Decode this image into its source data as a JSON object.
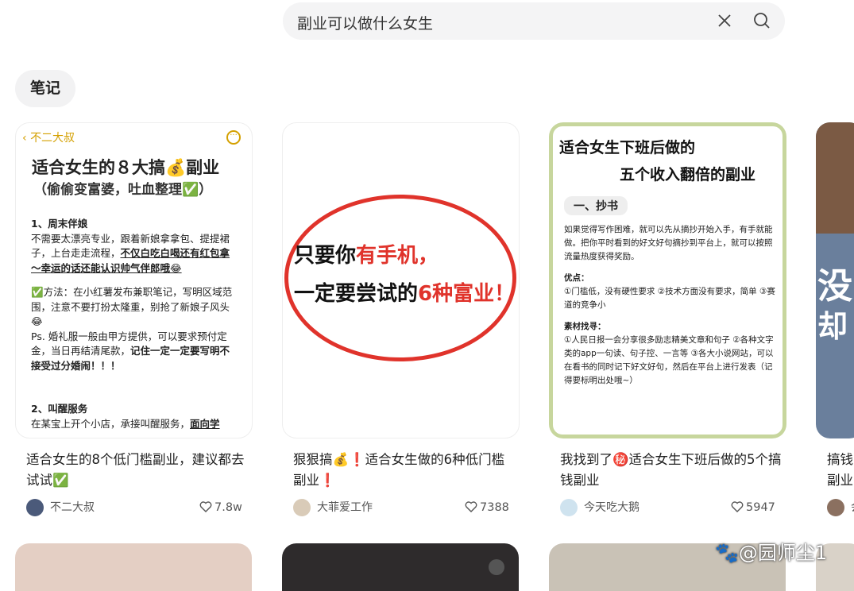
{
  "search": {
    "query": "副业可以做什么女生"
  },
  "filter": {
    "tag": "笔记"
  },
  "cards": [
    {
      "back_label": "不二大叔",
      "more_glyph": "···",
      "heading1": "适合女生的８大搞💰副业",
      "heading2": "（偷偷变富婆，吐血整理✅）",
      "s1_title": "1、周末伴娘",
      "s1_text": "不需要太漂亮专业，跟着新娘拿拿包、提提裙子，上台走走流程，",
      "s1_emph": "不仅白吃白喝还有红包拿～幸运的话还能认识帅气伴郎哦😂",
      "s1_method": "✅方法：在小红薯发布兼职笔记，写明区域范围，注意不要打扮太隆重，别抢了新娘子风头😂",
      "s1_ps": "Ps. 婚礼服一般由甲方提供，可以要求预付定金，当日再结清尾款，",
      "s1_ps_emph": "记住一定一定要写明不接受过分婚闹！！！",
      "s2_title": "2、叫醒服务",
      "s2_text": "在某宝上开个小店，承接叫醒服务，",
      "s2_emph": "面向学",
      "title": "适合女生的8个低门槛副业，建议都去试试✅",
      "author": "不二大叔",
      "likes": "7.8w"
    },
    {
      "line1_a": "只要你",
      "line1_b": "有手机，",
      "line2_a": "一定要尝试的",
      "line2_b": "6种富业！",
      "title": "狠狠搞💰❗适合女生做的6种低门槛副业❗",
      "author": "大菲爱工作",
      "likes": "7388"
    },
    {
      "t1": "适合女生下班后做的",
      "t2": "五个收入翻倍的副业",
      "section": "一、抄书",
      "p1": "如果觉得写作困难，就可以先从摘抄开始入手，有手就能做。把你平时看到的好文好句摘抄到平台上，就可以按照流量热度获得奖励。",
      "adv_title": "优点：",
      "adv": "①门槛低，没有硬性要求 ②技术方面没有要求，简单 ③赛道的竞争小",
      "src_title": "素材找寻：",
      "src": "①人民日报一会分享很多励志精美文章和句子 ②各种文字类的app一句读、句子控、一言等 ③各大小说网站，可以在看书的同时记下好文好句，然后在平台上进行发表（记得要标明出处哦~）",
      "title": "我找到了㊙️适合女生下班后做的5个搞钱副业",
      "author": "今天吃大鹅",
      "likes": "5947"
    },
    {
      "big1": "没",
      "big2": "却",
      "title": "搞钱副业",
      "author": "会"
    }
  ],
  "watermark": "🐾@园师尘1",
  "colors": {
    "accent": "#e0332b",
    "gold": "#d4a000",
    "border_green": "#c7d69d"
  }
}
